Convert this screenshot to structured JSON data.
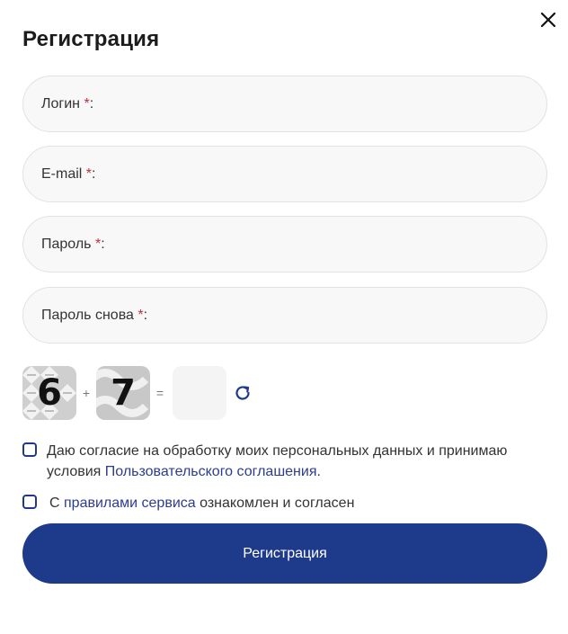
{
  "modal": {
    "title": "Регистрация",
    "close_icon": "close-icon"
  },
  "fields": [
    {
      "label": "Логин",
      "required_mark": "*",
      "suffix": ":"
    },
    {
      "label": "E-mail",
      "required_mark": "*",
      "suffix": ":"
    },
    {
      "label": "Пароль",
      "required_mark": "*",
      "suffix": ":"
    },
    {
      "label": "Пароль снова",
      "required_mark": "*",
      "suffix": ":"
    }
  ],
  "captcha": {
    "digit1": "6",
    "operator": "+",
    "digit2": "7",
    "equals": "=",
    "answer": "",
    "refresh_icon": "refresh-icon"
  },
  "consents": [
    {
      "text_before": "Даю согласие на обработку моих персональных данных и принимаю условия ",
      "link": "Пользовательского соглашения",
      "text_after": ".",
      "checked": false
    },
    {
      "text_before": "С ",
      "link": "правилами сервиса",
      "text_after": " ознакомлен и согласен",
      "checked": false
    }
  ],
  "submit_label": "Регистрация",
  "colors": {
    "primary": "#1e3a8a",
    "link": "#2b3d8f",
    "required": "#c0303a",
    "field_bg": "#f8f8f8",
    "field_border": "#e2e2e2"
  }
}
